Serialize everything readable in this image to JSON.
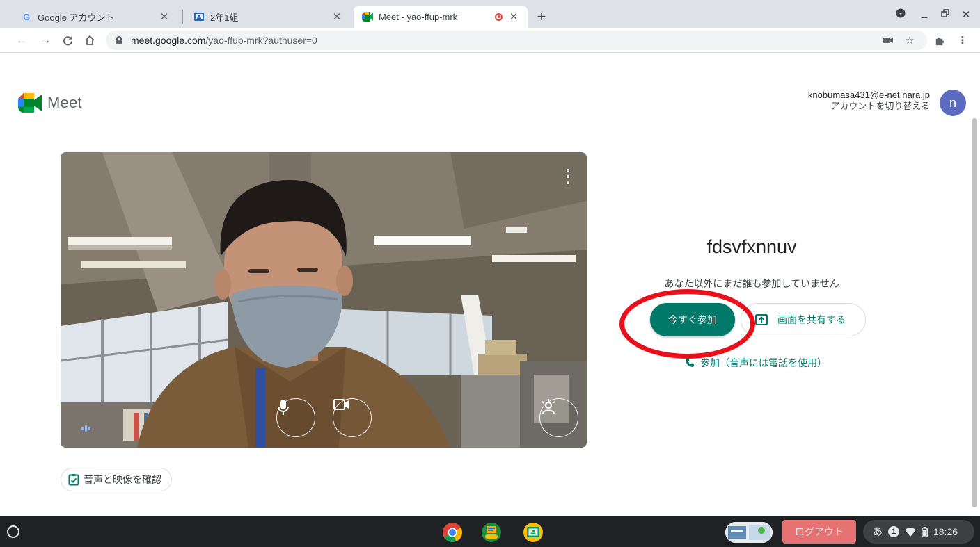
{
  "browser": {
    "tabs": [
      {
        "title": "Google アカウント",
        "icon": "google-g-icon",
        "active": false
      },
      {
        "title": "2年1組",
        "icon": "classroom-icon",
        "active": false
      },
      {
        "title": "Meet - yao-ffup-mrk",
        "icon": "meet-icon",
        "active": true,
        "recording": true
      }
    ],
    "url_host": "meet.google.com",
    "url_path": "/yao-ffup-mrk?authuser=0"
  },
  "header": {
    "logo_text": "Meet",
    "account_email": "knobumasa431@e-net.nara.jp",
    "switch_account": "アカウントを切り替える",
    "avatar_letter": "n"
  },
  "preview": {
    "check_av_label": "音声と映像を確認"
  },
  "join_panel": {
    "meeting_name": "fdsvfxnnuv",
    "status_text": "あなた以外にまだ誰も参加していません",
    "join_now_label": "今すぐ参加",
    "share_screen_label": "画面を共有する",
    "phone_join_label": "参加（音声には電話を使用）"
  },
  "shelf": {
    "logout_label": "ログアウト",
    "ime_label": "あ",
    "notification_count": "1",
    "time": "18:26"
  },
  "colors": {
    "accent": "#00796b",
    "annotation_ring": "#e8101a",
    "avatar": "#5c6bc0",
    "logout": "#e57373"
  }
}
